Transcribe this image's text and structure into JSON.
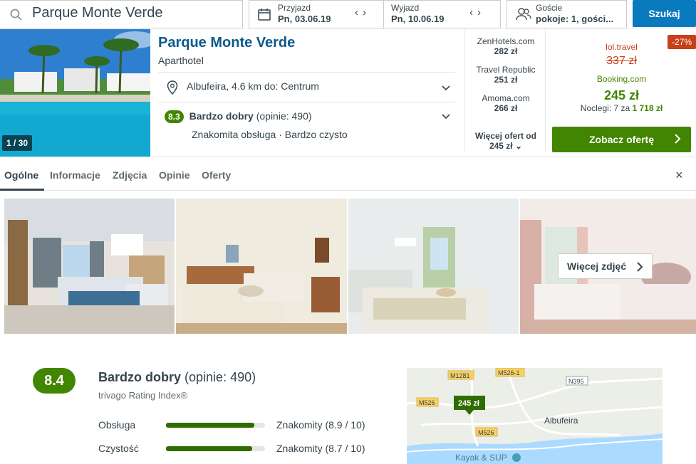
{
  "search": {
    "value": "Parque Monte Verde"
  },
  "dates": {
    "checkin_label": "Przyjazd",
    "checkin_value": "Pn, 03.06.19",
    "checkout_label": "Wyjazd",
    "checkout_value": "Pn, 10.06.19"
  },
  "guests": {
    "label": "Goście",
    "value": "pokoje: 1, gości..."
  },
  "search_button": "Szukaj",
  "hotel": {
    "photo_count": "1 / 30",
    "name": "Parque Monte Verde",
    "type": "Aparthotel",
    "location": "Albufeira, 4.6 km do: Centrum",
    "rating_score": "8.3",
    "rating_text": "Bardzo dobry",
    "rating_count": "(opinie: 490)",
    "rating_sub1": "Znakomita obsługa",
    "rating_sub2": "Bardzo czysto"
  },
  "offers": [
    {
      "site": "ZenHotels.com",
      "price": "282 zł"
    },
    {
      "site": "Travel Republic",
      "price": "251 zł"
    },
    {
      "site": "Amoma.com",
      "price": "266 zł"
    }
  ],
  "more_offers": {
    "line1": "Więcej ofert od",
    "line2": "245 zł"
  },
  "deal": {
    "discount": "-27%",
    "old_site": "lol.travel",
    "old_price": "337 zł",
    "site": "Booking.com",
    "price": "245 zł",
    "nights_prefix": "Noclegi: 7 za ",
    "nights_total": "1 718 zł",
    "button": "Zobacz ofertę"
  },
  "tabs": [
    "Ogólne",
    "Informacje",
    "Zdjęcia",
    "Opinie",
    "Oferty"
  ],
  "close_label": "×",
  "more_photos": "Więcej zdjęć",
  "review": {
    "score": "8.4",
    "title_bold": "Bardzo dobry",
    "title_count": "(opinie: 490)",
    "index_label": "trivago Rating Index®",
    "subscores": [
      {
        "label": "Obsługa",
        "value": "Znakomity (8.9 / 10)",
        "fraction": 0.89
      },
      {
        "label": "Czystość",
        "value": "Znakomity (8.7 / 10)",
        "fraction": 0.87
      }
    ]
  },
  "map": {
    "price_pin": "245 zł",
    "roads": [
      "M1281",
      "M526-1",
      "N395",
      "M526",
      "M526"
    ],
    "town": "Albufeira",
    "poi": "Kayak & SUP"
  },
  "colors": {
    "brand_blue": "#0a7abf",
    "deal_green": "#428500",
    "discount_red": "#c8401a"
  }
}
